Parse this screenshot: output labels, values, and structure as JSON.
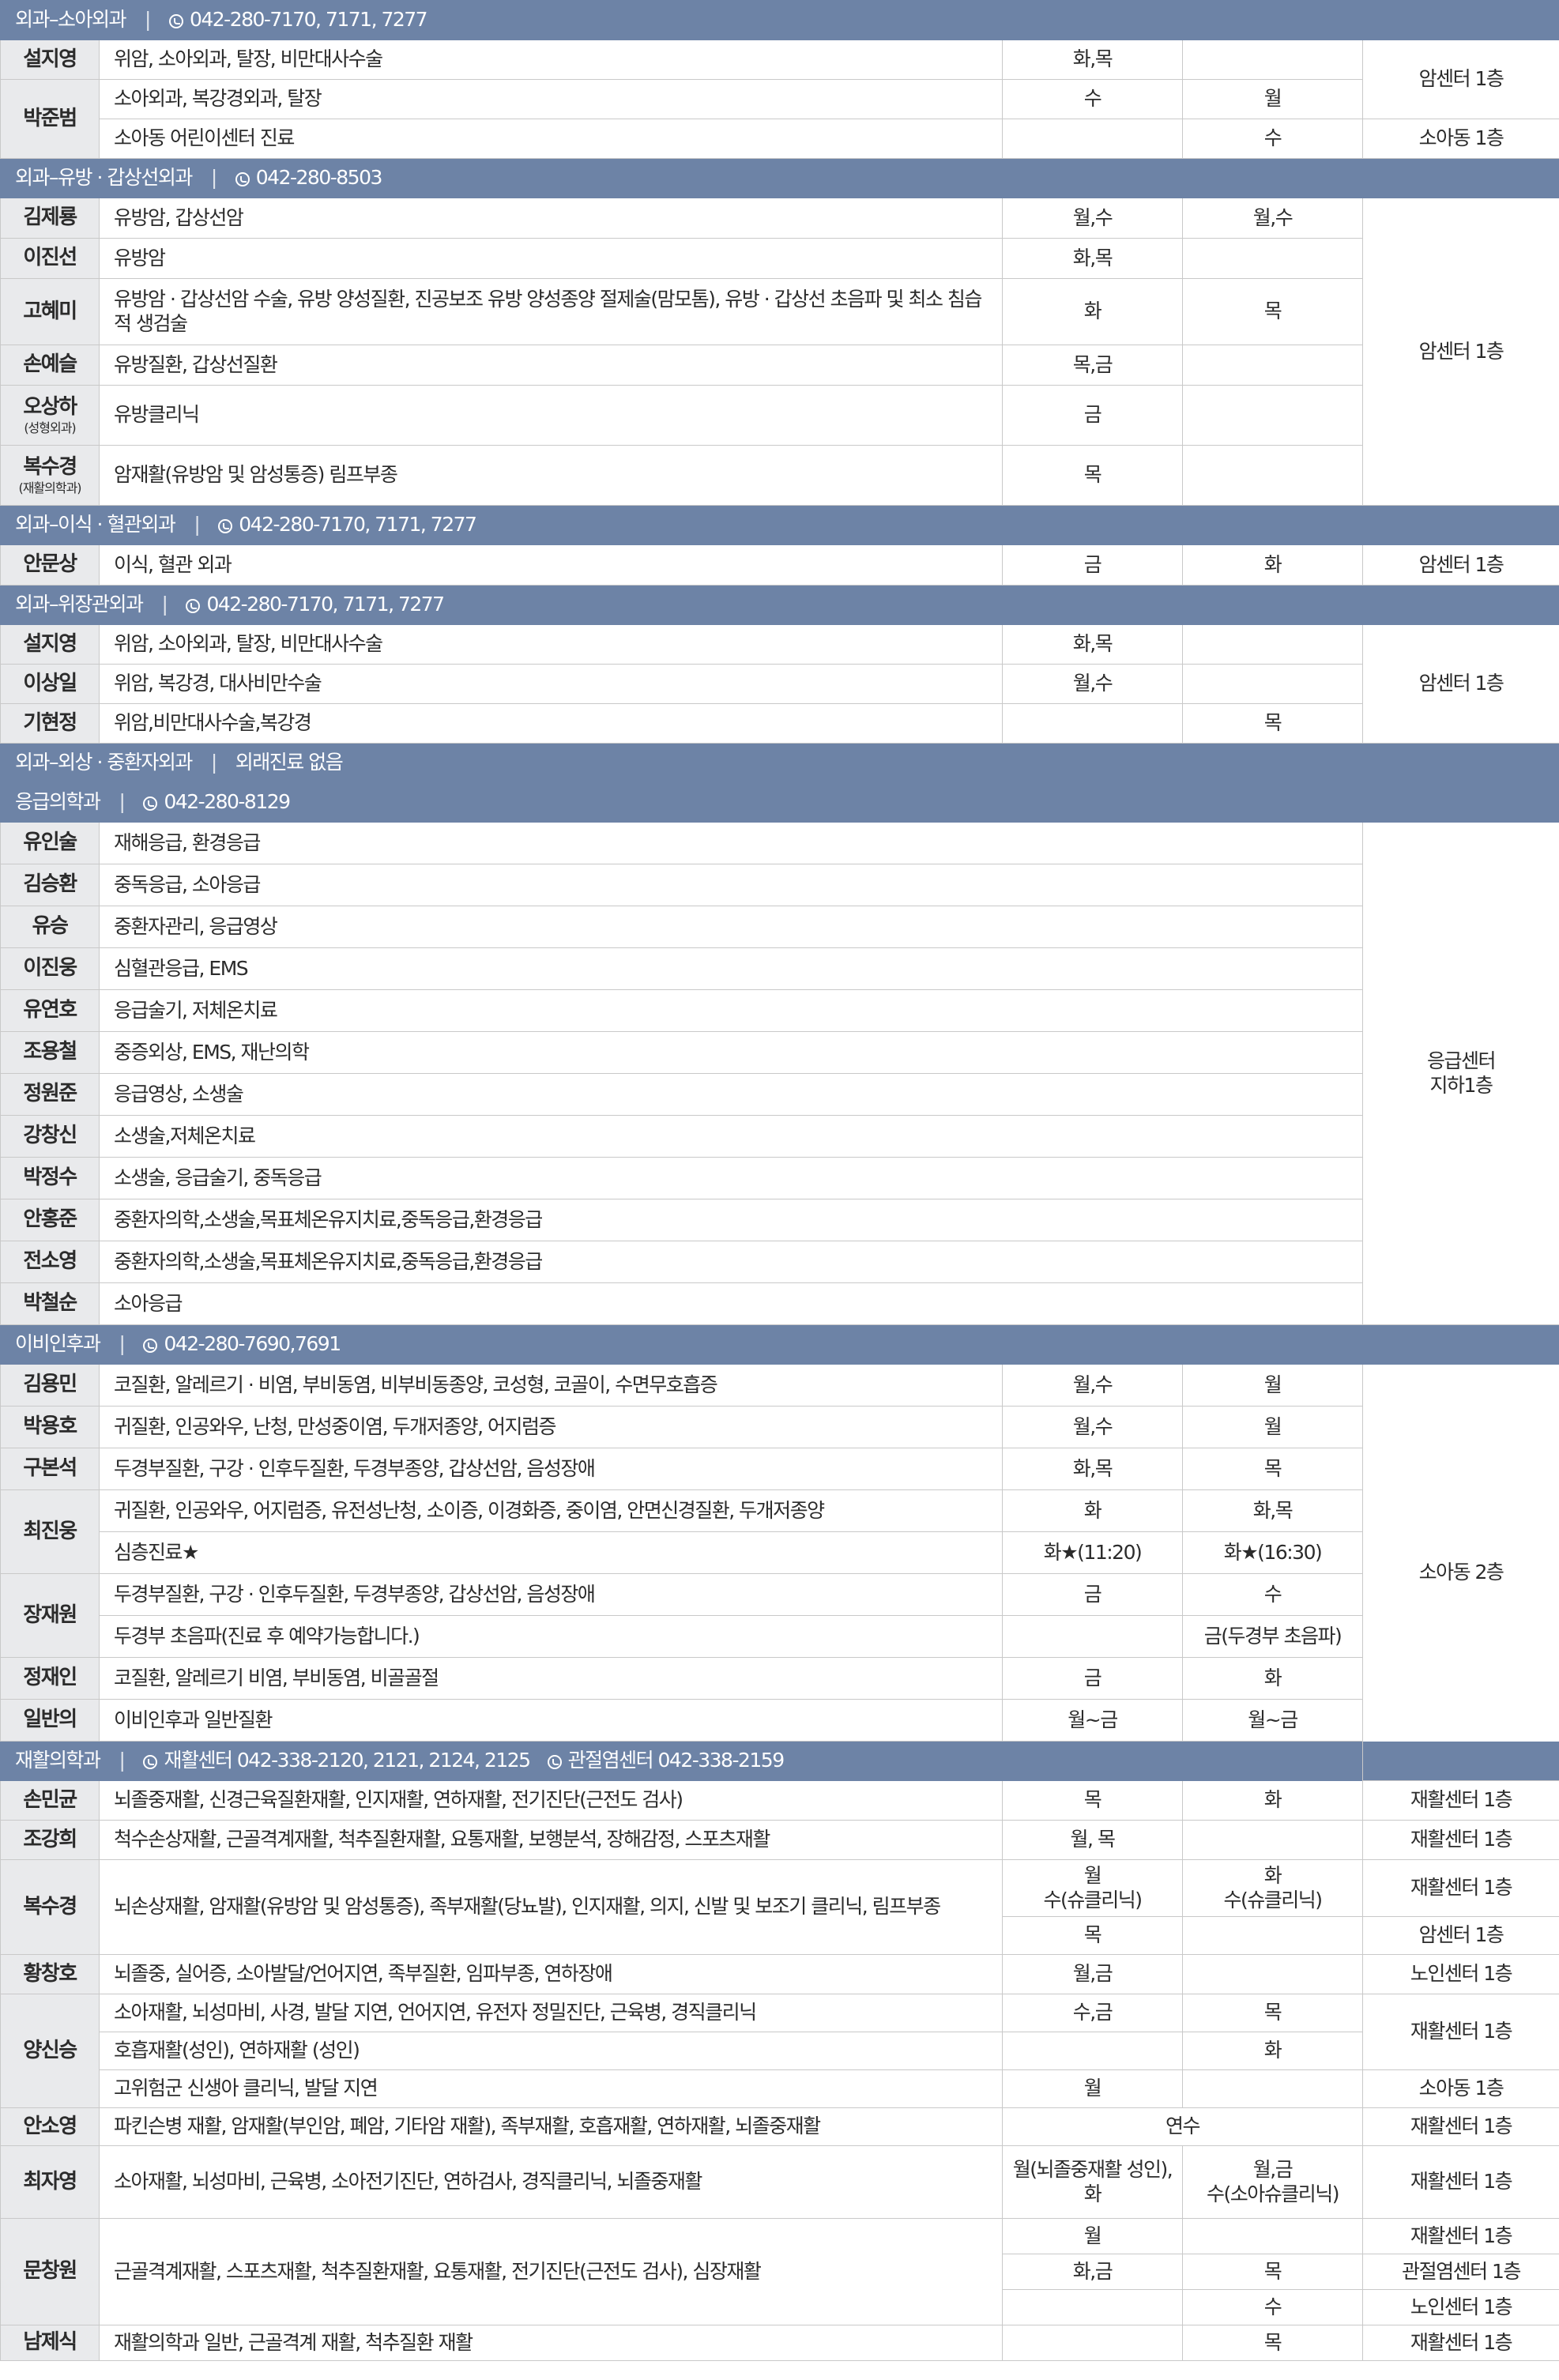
{
  "sections": [
    {
      "title": "외과–소아외과",
      "phones": [
        {
          "label": "",
          "number": "042-280-7170, 7171, 7277"
        }
      ],
      "rows": [
        {
          "h": 50,
          "name": "설지영",
          "name_rs": 1,
          "desc": "위암, 소아외과, 탈장, 비만대사수술",
          "am": "화,목",
          "pm": "",
          "loc": "암센터 1층",
          "loc_rs": 2
        },
        {
          "h": 50,
          "name": "박준범",
          "name_rs": 2,
          "desc": "소아외과, 복강경외과, 탈장",
          "am": "수",
          "pm": "월"
        },
        {
          "h": 50,
          "desc": "소아동 어린이센터 진료",
          "am": "",
          "pm": "수",
          "loc": "소아동 1층",
          "loc_rs": 1
        }
      ]
    },
    {
      "title": "외과–유방 · 갑상선외과",
      "phones": [
        {
          "label": "",
          "number": "042-280-8503"
        }
      ],
      "rows": [
        {
          "h": 51,
          "name": "김제룡",
          "name_rs": 1,
          "desc": "유방암, 갑상선암",
          "am": "월,수",
          "pm": "월,수",
          "loc": "암센터 1층",
          "loc_rs": 6
        },
        {
          "h": 51,
          "name": "이진선",
          "name_rs": 1,
          "desc": "유방암",
          "am": "화,목",
          "pm": ""
        },
        {
          "h": 84,
          "name": "고혜미",
          "name_rs": 1,
          "desc": "유방암 · 갑상선암 수술, 유방 양성질환, 진공보조 유방 양성종양 절제술(맘모톰), 유방 · 갑상선 초음파 및 최소 침습적 생검술",
          "am": "화",
          "pm": "목"
        },
        {
          "h": 51,
          "name": "손예슬",
          "name_rs": 1,
          "desc": "유방질환, 갑상선질환",
          "am": "목,금",
          "pm": ""
        },
        {
          "h": 76,
          "name": "오상하",
          "name_sub": "(성형외과)",
          "name_rs": 1,
          "desc": "유방클리닉",
          "am": "금",
          "pm": ""
        },
        {
          "h": 76,
          "name": "복수경",
          "name_sub": "(재활의학과)",
          "name_rs": 1,
          "desc": "암재활(유방암 및 암성통증) 림프부종",
          "am": "목",
          "pm": ""
        }
      ]
    },
    {
      "title": "외과–이식 · 혈관외과",
      "phones": [
        {
          "label": "",
          "number": "042-280-7170, 7171, 7277"
        }
      ],
      "rows": [
        {
          "h": 51,
          "name": "안문상",
          "name_rs": 1,
          "desc": "이식, 혈관 외과",
          "am": "금",
          "pm": "화",
          "loc": "암센터 1층",
          "loc_rs": 1
        }
      ]
    },
    {
      "title": "외과–위장관외과",
      "phones": [
        {
          "label": "",
          "number": "042-280-7170, 7171, 7277"
        }
      ],
      "rows": [
        {
          "h": 50,
          "name": "설지영",
          "name_rs": 1,
          "desc": "위암, 소아외과, 탈장, 비만대사수술",
          "am": "화,목",
          "pm": "",
          "loc": "암센터 1층",
          "loc_rs": 3
        },
        {
          "h": 50,
          "name": "이상일",
          "name_rs": 1,
          "desc": "위암, 복강경, 대사비만수술",
          "am": "월,수",
          "pm": ""
        },
        {
          "h": 50,
          "name": "기현정",
          "name_rs": 1,
          "desc": "위암,비만대사수술,복강경",
          "am": "",
          "pm": "목"
        }
      ]
    },
    {
      "title": "외과–외상 · 중환자외과",
      "note": "외래진료 없음",
      "phones": [],
      "rows": []
    },
    {
      "title": "응급의학과",
      "phones": [
        {
          "label": "",
          "number": "042-280-8129"
        }
      ],
      "rows": [
        {
          "h": 53,
          "name": "유인술",
          "name_rs": 1,
          "desc": "재해응급, 환경응급",
          "span": true,
          "loc": "응급센터\n지하1층",
          "loc_rs": 12
        },
        {
          "h": 53,
          "name": "김승환",
          "name_rs": 1,
          "desc": "중독응급, 소아응급",
          "span": true
        },
        {
          "h": 53,
          "name": "유승",
          "name_rs": 1,
          "desc": "중환자관리, 응급영상",
          "span": true
        },
        {
          "h": 53,
          "name": "이진웅",
          "name_rs": 1,
          "desc": "심혈관응급, EMS",
          "span": true
        },
        {
          "h": 53,
          "name": "유연호",
          "name_rs": 1,
          "desc": "응급술기, 저체온치료",
          "span": true
        },
        {
          "h": 53,
          "name": "조용철",
          "name_rs": 1,
          "desc": "중증외상, EMS, 재난의학",
          "span": true
        },
        {
          "h": 53,
          "name": "정원준",
          "name_rs": 1,
          "desc": "응급영상, 소생술",
          "span": true
        },
        {
          "h": 53,
          "name": "강창신",
          "name_rs": 1,
          "desc": "소생술,저체온치료",
          "span": true
        },
        {
          "h": 53,
          "name": "박정수",
          "name_rs": 1,
          "desc": "소생술, 응급술기, 중독응급",
          "span": true
        },
        {
          "h": 53,
          "name": "안홍준",
          "name_rs": 1,
          "desc": "중환자의학,소생술,목표체온유지치료,중독응급,환경응급",
          "span": true
        },
        {
          "h": 53,
          "name": "전소영",
          "name_rs": 1,
          "desc": "중환자의학,소생술,목표체온유지치료,중독응급,환경응급",
          "span": true
        },
        {
          "h": 53,
          "name": "박철순",
          "name_rs": 1,
          "desc": "소아응급",
          "span": true
        }
      ]
    },
    {
      "title": "이비인후과",
      "phones": [
        {
          "label": "",
          "number": "042-280-7690,7691"
        }
      ],
      "rows": [
        {
          "h": 53,
          "name": "김용민",
          "name_rs": 1,
          "desc": "코질환, 알레르기 · 비염, 부비동염, 비부비동종양, 코성형, 코골이, 수면무호흡증",
          "am": "월,수",
          "pm": "월",
          "loc": "소아동 2층",
          "loc_rs": 10
        },
        {
          "h": 53,
          "name": "박용호",
          "name_rs": 1,
          "desc": "귀질환, 인공와우, 난청, 만성중이염, 두개저종양, 어지럼증",
          "am": "월,수",
          "pm": "월"
        },
        {
          "h": 53,
          "name": "구본석",
          "name_rs": 1,
          "desc": "두경부질환, 구강 · 인후두질환, 두경부종양, 갑상선암, 음성장애",
          "am": "화,목",
          "pm": "목"
        },
        {
          "h": 53,
          "name": "최진웅",
          "name_rs": 2,
          "desc": "귀질환, 인공와우, 어지럼증, 유전성난청, 소이증, 이경화증, 중이염, 안면신경질환, 두개저종양",
          "am": "화",
          "pm": "화,목"
        },
        {
          "h": 53,
          "desc": "심층진료★",
          "am": "화★(11:20)",
          "pm": "화★(16:30)"
        },
        {
          "h": 53,
          "name": "장재원",
          "name_rs": 2,
          "desc": "두경부질환, 구강 · 인후두질환, 두경부종양, 갑상선암, 음성장애",
          "am": "금",
          "pm": "수"
        },
        {
          "h": 53,
          "desc": "두경부 초음파(진료 후 예약가능합니다.)",
          "am": "",
          "pm": "금(두경부 초음파)"
        },
        {
          "h": 53,
          "name": "정재인",
          "name_rs": 1,
          "desc": "코질환, 알레르기 비염, 부비동염, 비골골절",
          "am": "금",
          "pm": "화"
        },
        {
          "h": 53,
          "name": "일반의",
          "name_rs": 1,
          "desc": "이비인후과 일반질환",
          "am": "월~금",
          "pm": "월~금"
        }
      ]
    },
    {
      "title": "재활의학과",
      "phones": [
        {
          "label": "재활센터",
          "number": "042-338-2120, 2121, 2124, 2125"
        },
        {
          "label": "관절염센터",
          "number": "042-338-2159"
        }
      ],
      "rows": [
        {
          "h": 50,
          "name": "손민균",
          "name_rs": 1,
          "desc": "뇌졸중재활, 신경근육질환재활, 인지재활, 연하재활, 전기진단(근전도 검사)",
          "desc_rs": 1,
          "am": "목",
          "pm": "화",
          "loc": "재활센터 1층",
          "loc_rs": 1
        },
        {
          "h": 50,
          "name": "조강희",
          "name_rs": 1,
          "desc": "척수손상재활, 근골격계재활, 척추질환재활, 요통재활, 보행분석, 장해감정, 스포츠재활",
          "desc_rs": 1,
          "am": "월, 목",
          "pm": "",
          "loc": "재활센터 1층",
          "loc_rs": 1
        },
        {
          "h": 72,
          "name": "복수경",
          "name_rs": 2,
          "desc": "뇌손상재활, 암재활(유방암 및 암성통증), 족부재활(당뇨발), 인지재활, 의지, 신발 및 보조기 클리닉, 림프부종",
          "desc_rs": 2,
          "am": "월\n수(슈클리닉)",
          "pm": "화\n수(슈클리닉)",
          "loc": "재활센터 1층",
          "loc_rs": 1
        },
        {
          "h": 48,
          "am": "목",
          "pm": "",
          "loc": "암센터 1층",
          "loc_rs": 1
        },
        {
          "h": 50,
          "name": "황창호",
          "name_rs": 1,
          "desc": "뇌졸중, 실어증, 소아발달/언어지연, 족부질환, 임파부종, 연하장애",
          "desc_rs": 1,
          "am": "월,금",
          "pm": "",
          "loc": "노인센터 1층",
          "loc_rs": 1
        },
        {
          "h": 48,
          "name": "양신승",
          "name_rs": 3,
          "desc": "소아재활, 뇌성마비, 사경, 발달 지연, 언어지연,  유전자 정밀진단, 근육병, 경직클리닉",
          "desc_rs": 1,
          "am": "수,금",
          "pm": "목",
          "loc": "재활센터 1층",
          "loc_rs": 2
        },
        {
          "h": 48,
          "desc": "호흡재활(성인), 연하재활 (성인)",
          "desc_rs": 1,
          "am": "",
          "pm": "화"
        },
        {
          "h": 48,
          "desc": "고위험군 신생아 클리닉, 발달 지연",
          "desc_rs": 1,
          "am": "월",
          "pm": "",
          "loc": "소아동 1층",
          "loc_rs": 1
        },
        {
          "h": 48,
          "name": "안소영",
          "name_rs": 1,
          "desc": "파킨슨병 재활, 암재활(부인암, 폐암, 기타암 재활), 족부재활, 호흡재활, 연하재활, 뇌졸중재활",
          "desc_rs": 1,
          "merged": "연수",
          "loc": "재활센터 1층",
          "loc_rs": 1
        },
        {
          "h": 92,
          "name": "최자영",
          "name_rs": 1,
          "desc": "소아재활, 뇌성마비, 근육병, 소아전기진단, 연하검사, 경직클리닉, 뇌졸중재활",
          "desc_rs": 1,
          "am": "월(뇌졸중재활 성인),\n화",
          "pm": "월,금\n수(소아슈클리닉)",
          "loc": "재활센터 1층",
          "loc_rs": 1
        },
        {
          "h": 45,
          "name": "문창원",
          "name_rs": 3,
          "desc": "근골격계재활, 스포츠재활, 척추질환재활, 요통재활, 전기진단(근전도 검사), 심장재활",
          "desc_rs": 3,
          "am": "월",
          "pm": "",
          "loc": "재활센터 1층",
          "loc_rs": 1
        },
        {
          "h": 45,
          "am": "화,금",
          "pm": "목",
          "loc": "관절염센터 1층",
          "loc_rs": 1
        },
        {
          "h": 45,
          "am": "",
          "pm": "수",
          "loc": "노인센터 1층",
          "loc_rs": 1
        },
        {
          "h": 45,
          "name": "남제식",
          "name_rs": 1,
          "desc": "재활의학과 일반, 근골격계 재활, 척추질환 재활",
          "desc_rs": 1,
          "am": "",
          "pm": "목",
          "loc": "재활센터 1층",
          "loc_rs": 1
        }
      ]
    }
  ]
}
